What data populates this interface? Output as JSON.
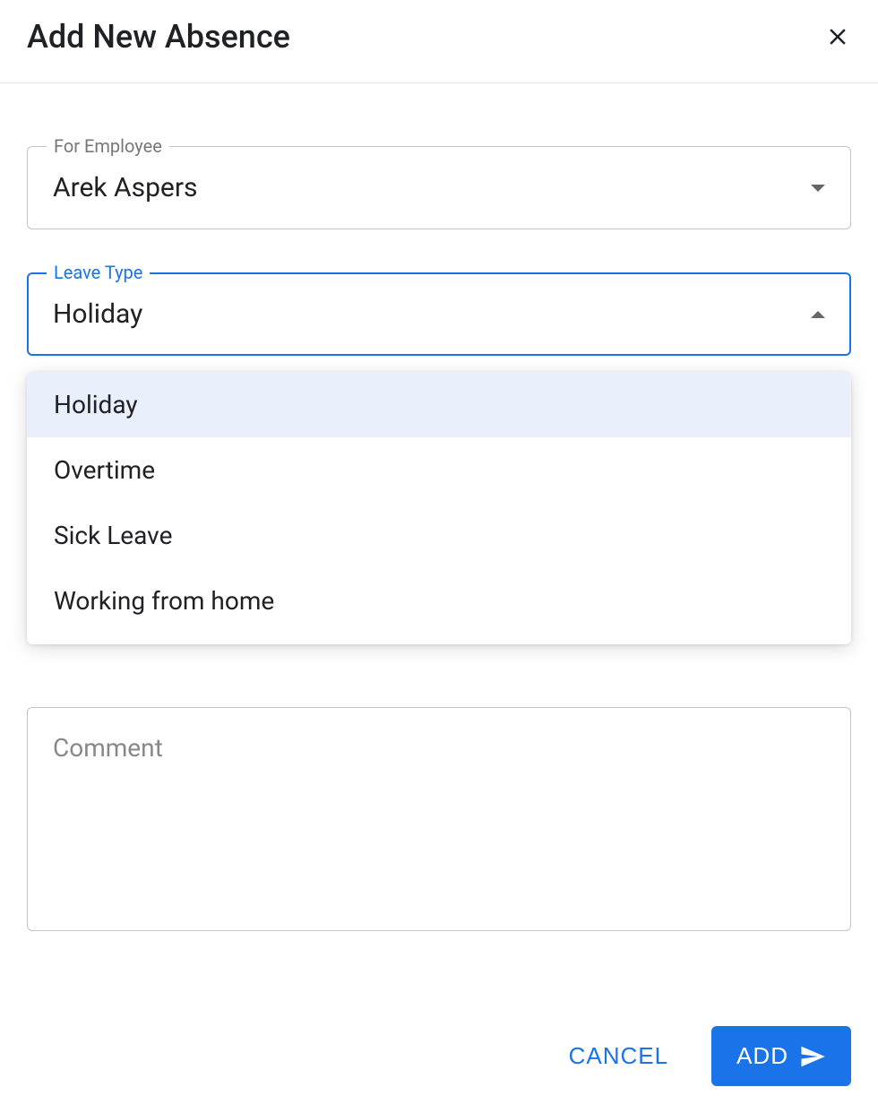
{
  "header": {
    "title": "Add New Absence"
  },
  "form": {
    "employee": {
      "label": "For Employee",
      "value": "Arek Aspers"
    },
    "leaveType": {
      "label": "Leave Type",
      "value": "Holiday",
      "options": [
        {
          "label": "Holiday",
          "selected": true
        },
        {
          "label": "Overtime",
          "selected": false
        },
        {
          "label": "Sick Leave",
          "selected": false
        },
        {
          "label": "Working from home",
          "selected": false
        }
      ]
    },
    "comment": {
      "placeholder": "Comment",
      "value": ""
    }
  },
  "footer": {
    "cancelLabel": "CANCEL",
    "addLabel": "ADD"
  }
}
